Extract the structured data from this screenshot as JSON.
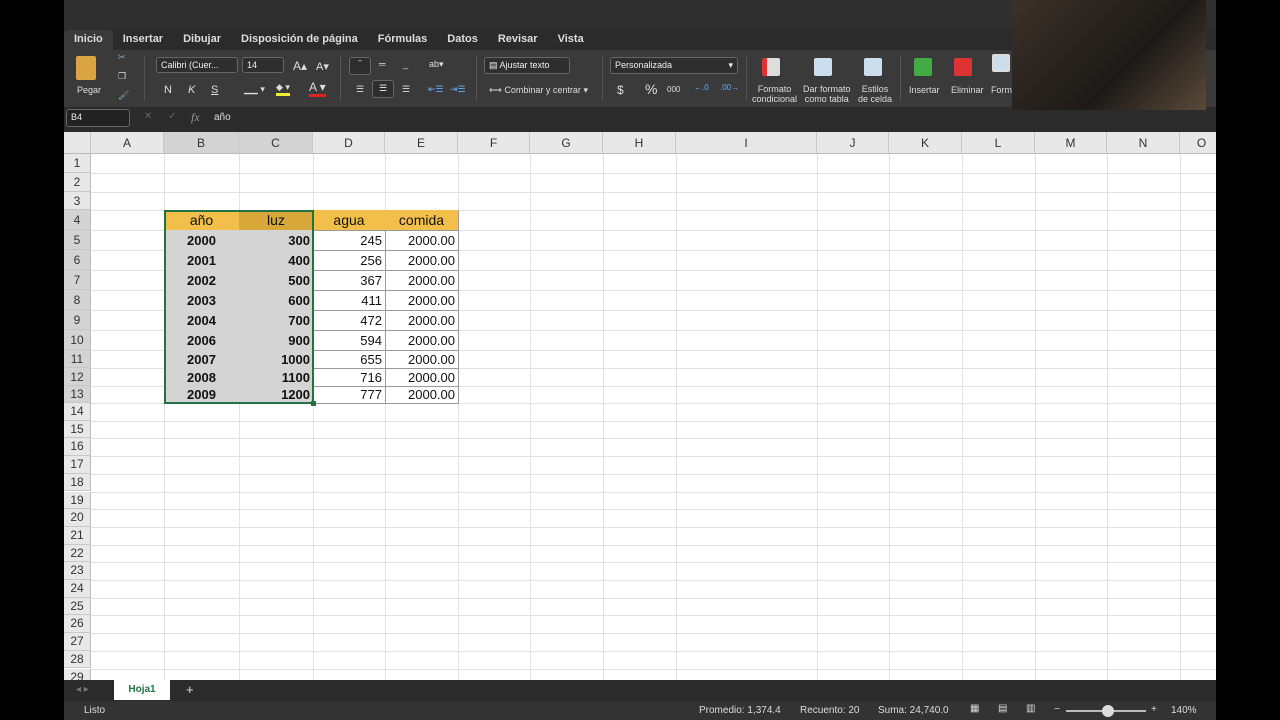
{
  "tabs": [
    "Inicio",
    "Insertar",
    "Dibujar",
    "Disposición de página",
    "Fórmulas",
    "Datos",
    "Revisar",
    "Vista"
  ],
  "ribbon": {
    "paste": "Pegar",
    "font_name": "Calibri (Cuer...",
    "font_size": "14",
    "bold": "N",
    "italic": "K",
    "underline": "S",
    "wrap": "Ajustar texto",
    "merge": "Combinar y centrar",
    "number_format": "Personalizada",
    "currency": "$",
    "percent": "%",
    "thousands": "000",
    "cond_format": [
      "Formato",
      "condicional"
    ],
    "table_format": [
      "Dar formato",
      "como tabla"
    ],
    "cell_styles": [
      "Estilos",
      "de celda"
    ],
    "insert": "Insertar",
    "delete": "Eliminar",
    "format": "Form"
  },
  "formula_bar": {
    "cell_ref": "B4",
    "fx": "fx",
    "value": "año"
  },
  "columns": [
    "A",
    "B",
    "C",
    "D",
    "E",
    "F",
    "G",
    "H",
    "I",
    "J",
    "K",
    "L",
    "M",
    "N",
    "O"
  ],
  "table": {
    "headers": [
      "año",
      "luz",
      "agua",
      "comida"
    ],
    "rows": [
      [
        "2000",
        "300",
        "245",
        "2000.00"
      ],
      [
        "2001",
        "400",
        "256",
        "2000.00"
      ],
      [
        "2002",
        "500",
        "367",
        "2000.00"
      ],
      [
        "2003",
        "600",
        "411",
        "2000.00"
      ],
      [
        "2004",
        "700",
        "472",
        "2000.00"
      ],
      [
        "2006",
        "900",
        "594",
        "2000.00"
      ],
      [
        "2007",
        "1000",
        "655",
        "2000.00"
      ],
      [
        "2008",
        "1100",
        "716",
        "2000.00"
      ],
      [
        "2009",
        "1200",
        "777",
        "2000.00"
      ]
    ]
  },
  "sheet_tab": "Hoja1",
  "status": {
    "ready": "Listo",
    "average": "Promedio: 1,374.4",
    "count": "Recuento: 20",
    "sum": "Suma: 24,740.0",
    "zoom": "140%",
    "zoom_percent": 140
  },
  "colors": {
    "header_fill": "#f2c04a",
    "selection_fill": "#d4d4d4",
    "selection_border": "#217346"
  }
}
